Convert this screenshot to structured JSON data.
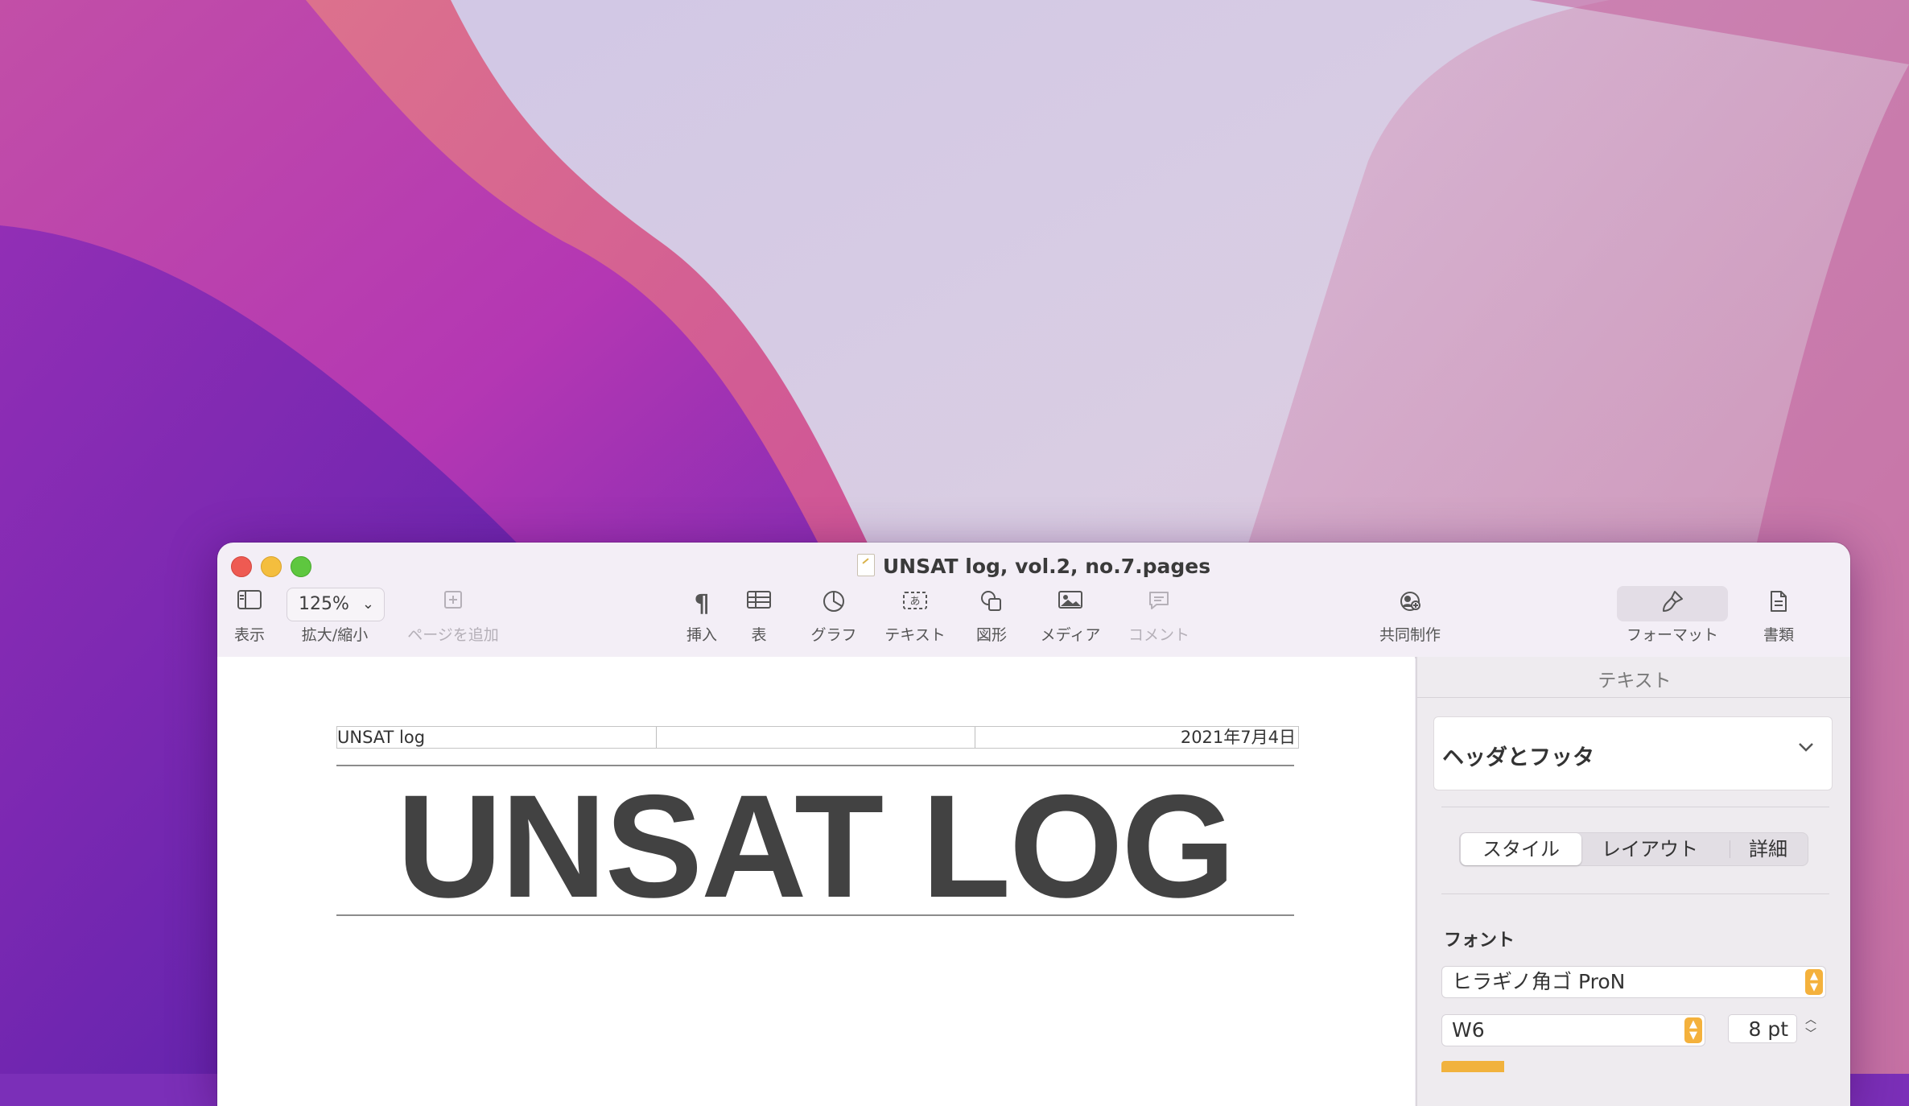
{
  "window": {
    "title": "UNSAT log, vol.2, no.7.pages"
  },
  "toolbar": {
    "view_label": "表示",
    "zoom_value": "125%",
    "zoom_label": "拡大/縮小",
    "add_page_label": "ページを追加",
    "insert_label": "挿入",
    "table_label": "表",
    "chart_label": "グラフ",
    "text_label": "テキスト",
    "shape_label": "図形",
    "media_label": "メディア",
    "comment_label": "コメント",
    "collaborate_label": "共同制作",
    "format_label": "フォーマット",
    "document_label": "書類"
  },
  "document": {
    "header_left": "UNSAT log",
    "header_right": "2021年7月4日",
    "title": "UNSAT LOG"
  },
  "inspector": {
    "tab_title": "テキスト",
    "style_name": "ヘッダとフッタ",
    "segments": [
      "スタイル",
      "レイアウト",
      "詳細"
    ],
    "font_section": "フォント",
    "font_family": "ヒラギノ角ゴ ProN",
    "font_weight": "W6",
    "font_size": "8 pt",
    "accent_color": "#f4b13c"
  }
}
